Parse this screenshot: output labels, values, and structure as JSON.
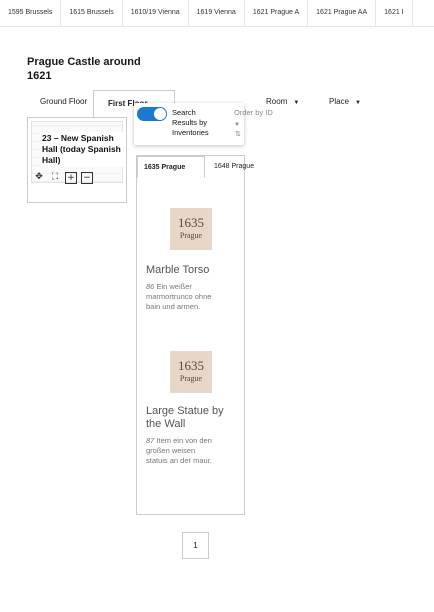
{
  "top_tabs": [
    "1595 Brussels",
    "1615 Brussels",
    "1610/19 Vienna",
    "1619 Vienna",
    "1621 Prague A",
    "1621 Prague AA",
    "1621 I"
  ],
  "page_title": "Prague Castle around 1621",
  "floor_tabs": {
    "ground": "Ground Floor",
    "first": "First Floor",
    "room": "Room",
    "place": "Place"
  },
  "map": {
    "label": "23 – New Spanish Hall (today Spanish Hall)",
    "tools": [
      "move-icon",
      "fullscreen-icon",
      "zoom-in-icon",
      "zoom-out-icon"
    ]
  },
  "search": {
    "toggle_label": "Search Results by Inventories",
    "toggle_on": true,
    "order_label": "Order by ID"
  },
  "inventory": {
    "tabs": [
      "1635 Prague",
      "1648 Prague"
    ],
    "active_tab": 0,
    "items": [
      {
        "badge_year": "1635",
        "badge_city": "Prague",
        "title": "Marble Torso",
        "number": "86",
        "description": "Ein weißer marmortrunco ohne bain und armen."
      },
      {
        "badge_year": "1635",
        "badge_city": "Prague",
        "title": "Large Statue by the Wall",
        "number": "87",
        "description": "Item ein von den großen weisen statuis an der maur."
      }
    ]
  },
  "pagination": {
    "current": "1"
  },
  "colors": {
    "accent": "#1b79d1",
    "badge_bg": "#e7d7c8"
  }
}
